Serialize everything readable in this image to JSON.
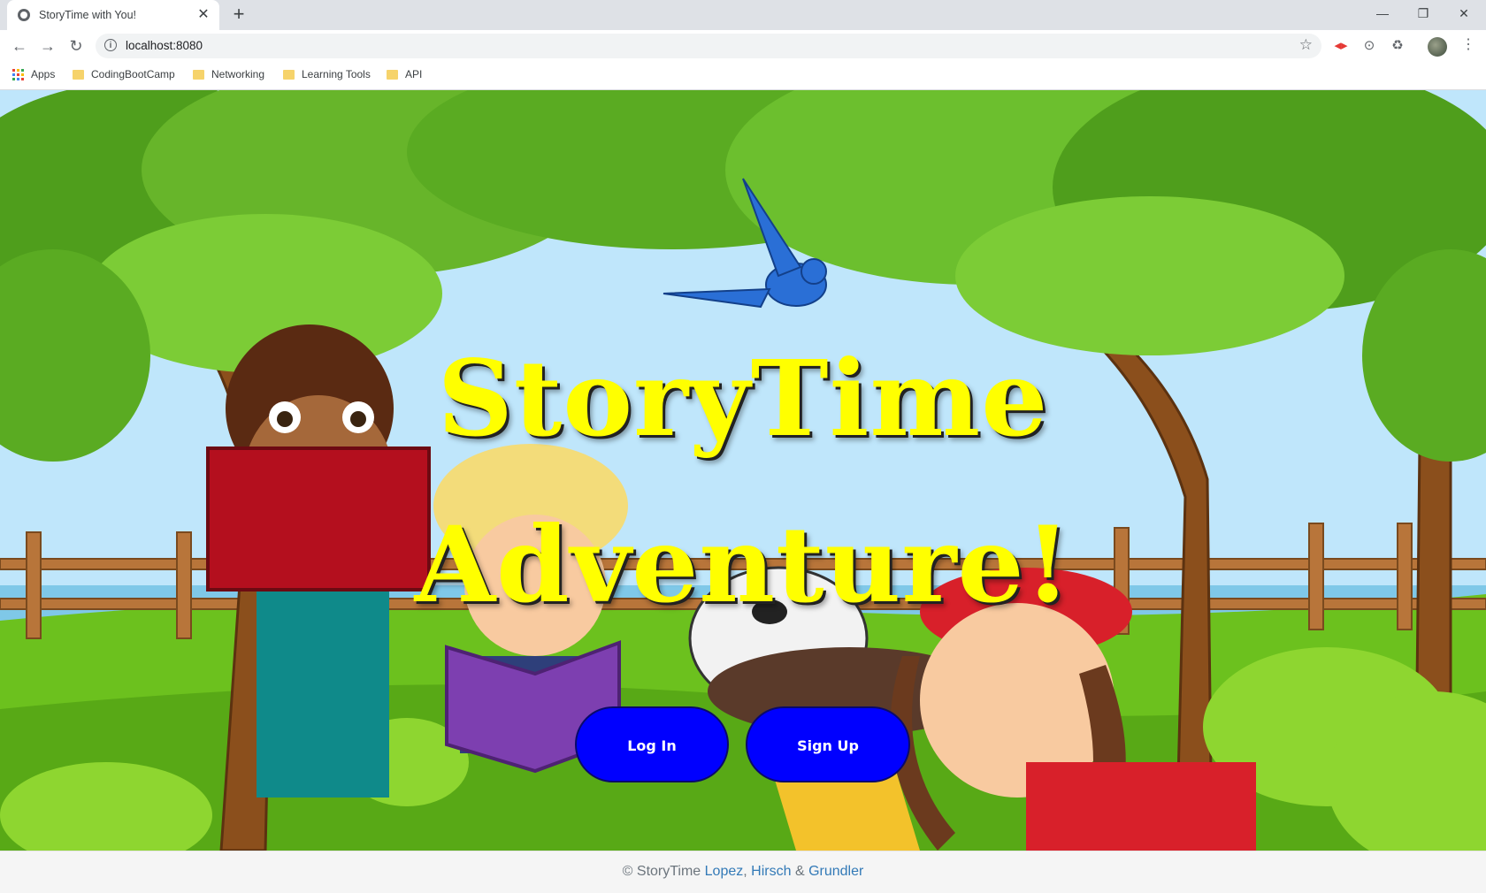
{
  "browser": {
    "tab_title": "StoryTime with You!",
    "url": "localhost:8080",
    "bookmarks": [
      {
        "label": "Apps",
        "kind": "apps"
      },
      {
        "label": "CodingBootCamp",
        "kind": "folder"
      },
      {
        "label": "Networking",
        "kind": "folder"
      },
      {
        "label": "Learning Tools",
        "kind": "folder"
      },
      {
        "label": "API",
        "kind": "folder"
      }
    ],
    "icons": [
      "back-icon",
      "forward-icon",
      "reload-icon",
      "info-icon",
      "star-icon",
      "extension-icon",
      "menu-icon"
    ]
  },
  "hero": {
    "title_line1": "StoryTime",
    "title_line2": "Adventure!",
    "title_color": "#ffff00"
  },
  "actions": {
    "login_label": "Log In",
    "signup_label": "Sign Up",
    "button_color": "#0000ff"
  },
  "footer": {
    "prefix": "© StoryTime",
    "author1": "Lopez",
    "sep1": ",",
    "author2": "Hirsch",
    "sep2": "&",
    "author3": "Grundler"
  }
}
